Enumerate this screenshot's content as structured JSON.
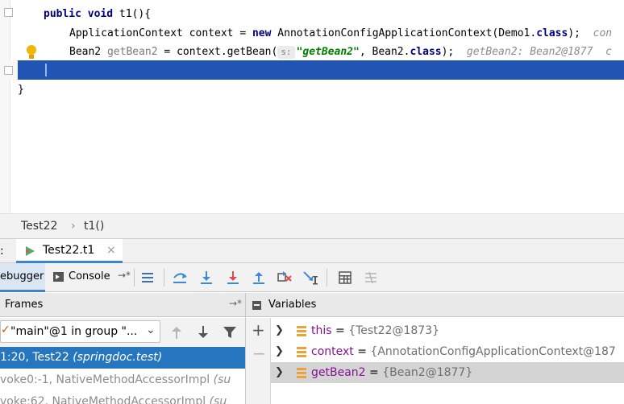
{
  "editor": {
    "lines": [
      {
        "kw1": "public",
        "kw2": "void",
        "rest": " t1(){"
      },
      {
        "a": "ApplicationContext context = ",
        "kw": "new",
        "b": " AnnotationConfigApplicationContext(Demo1.",
        "kw2": "class",
        "c": ");  ",
        "hint": "con"
      },
      {
        "a": "Bean2 ",
        "hint1": "getBean2",
        "b": " = context.getBean(",
        "param": "s:",
        "str": "\"getBean2\"",
        "c": ", Bean2.",
        "kw": "class",
        "d": ");  ",
        "hint2": "getBean2: Bean2@1877",
        "e": "  c"
      },
      {
        "a": "}"
      }
    ]
  },
  "breadcrumb": {
    "class": "Test22",
    "separator": "›",
    "method": "t1()"
  },
  "debug_tabs": {
    "colon": ":",
    "run_tab": "Test22.t1",
    "close": "×"
  },
  "toolbar": {
    "debugger_tab": "ebugger",
    "console_tab": "Console",
    "console_pin": "→*"
  },
  "frames": {
    "title": "Frames",
    "pin": "→*",
    "thread": "\"main\"@1 in group \"...",
    "thread_check": "✓",
    "items": [
      {
        "text": "1:20, Test22 ",
        "pkg": "(springdoc.test)"
      },
      {
        "text": "voke0:-1, NativeMethodAccessorImpl ",
        "pkg": "(su"
      },
      {
        "text": "voke:62, NativeMethodAccessorImpl ",
        "pkg": "(su"
      }
    ]
  },
  "variables": {
    "title": "Variables",
    "side_plus": "+",
    "side_minus": "−",
    "items": [
      {
        "name": "this",
        "value": "{Test22@1873}"
      },
      {
        "name": "context",
        "value": "{AnnotationConfigApplicationContext@187"
      },
      {
        "name": "getBean2",
        "value": "{Bean2@1877}"
      }
    ]
  },
  "colors": {
    "execution_line": "#2154b3",
    "selected_frame": "#2675bf",
    "keyword": "#000080",
    "string": "#008000",
    "variable_name": "#871094"
  }
}
